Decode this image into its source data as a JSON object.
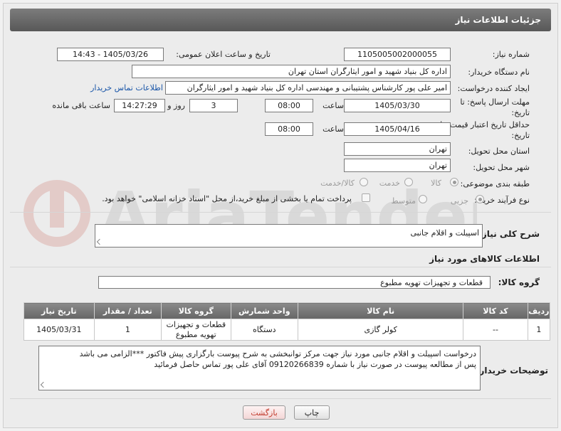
{
  "header": {
    "title": "جزئیات اطلاعات نیاز"
  },
  "fields": {
    "need_number_label": "شماره نیاز:",
    "need_number": "1105005002000055",
    "announce_label": "تاریخ و ساعت اعلان عمومی:",
    "announce_value": "1405/03/26 - 14:43",
    "buyer_org_label": "نام دستگاه خریدار:",
    "buyer_org": "اداره کل بنیاد شهید و امور ایثارگران استان تهران",
    "requester_label": "ایجاد کننده درخواست:",
    "requester": "امیر علی پور کارشناس پشتیبانی و مهندسی اداره کل بنیاد شهید و امور ایثارگران",
    "buyer_contact_link": "اطلاعات تماس خریدار",
    "reply_deadline_label": "مهلت ارسال پاسخ: تا تاریخ:",
    "reply_date": "1405/03/30",
    "time_label": "ساعت",
    "reply_time": "08:00",
    "days_value": "3",
    "days_label": "روز و",
    "remaining_time": "14:27:29",
    "remaining_label": "ساعت باقی مانده",
    "price_validity_label": "حداقل تاریخ اعتبار قیمت: تا تاریخ:",
    "price_date": "1405/04/16",
    "price_time": "08:00",
    "province_label": "استان محل تحویل:",
    "province": "تهران",
    "city_label": "شهر محل تحویل:",
    "city": "تهران",
    "category_label": "طبقه بندی موضوعی:",
    "category_options": [
      "کالا",
      "خدمت",
      "کالا/خدمت"
    ],
    "process_label": "نوع فرآیند خرید :",
    "process_options": [
      "جزیی",
      "متوسط"
    ],
    "payment_note": "پرداخت تمام یا بخشی از مبلغ خرید،از محل \"اسناد خزانه اسلامی\" خواهد بود."
  },
  "description": {
    "label": "شرح کلی نیاز:",
    "value": "اسپیلت و اقلام جانبی"
  },
  "goods_section": {
    "title": "اطلاعات کالاهای مورد نیاز",
    "group_label": "گروه کالا:",
    "group_value": "قطعات و تجهیزات تهویه مطبوع"
  },
  "table": {
    "headers": [
      "ردیف",
      "کد کالا",
      "نام کالا",
      "واحد شمارش",
      "گروه کالا",
      "تعداد / مقدار",
      "تاریخ نیاز"
    ],
    "rows": [
      [
        "1",
        "--",
        "کولر گازی",
        "دستگاه",
        "قطعات و تجهیزات تهویه مطبوع",
        "1",
        "1405/03/31"
      ]
    ]
  },
  "buyer_notes": {
    "label": "توضیحات خریدار:",
    "line1": "درخواست اسپیلت و اقلام جانبی مورد نیاز جهت مرکز توانبخشی به شرح پیوست بارگزاری پیش فاکتور ***الزامی می باشد",
    "line2": "پس از مطالعه پیوست در صورت نیاز با شماره 09120266839 آقای علی پور تماس حاصل فرمائید"
  },
  "buttons": {
    "print": "چاپ",
    "back": "بازگشت"
  },
  "colors": {
    "header_bg": "#666666",
    "link": "#1a56a8",
    "back_button_text": "#c0392b"
  }
}
